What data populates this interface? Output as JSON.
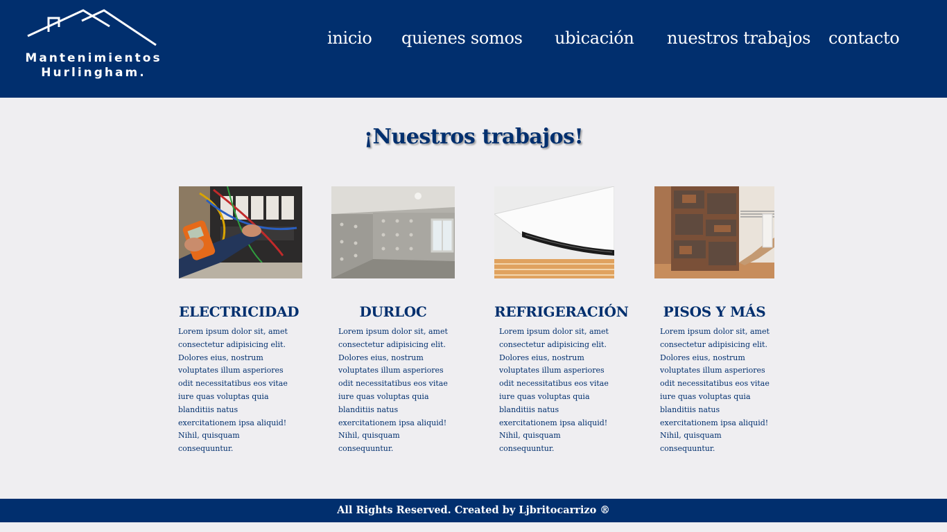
{
  "brand": {
    "line1": "Mantenimientos",
    "line2": "Hurlingham."
  },
  "nav": {
    "inicio": "inicio",
    "quienes": "quienes somos",
    "ubicacion": "ubicación",
    "trabajos": "nuestros trabajos",
    "contacto": "contacto"
  },
  "main": {
    "title": "¡Nuestros trabajos!"
  },
  "cards": [
    {
      "title": "ELECTRICIDAD",
      "image": "electrical-panel-photo",
      "lines": [
        "Lorem ipsum dolor sit, amet",
        "consectetur adipisicing elit.",
        "Dolores eius, nostrum",
        "voluptates illum asperiores",
        "odit necessitatibus eos vitae",
        "iure quas voluptas quia",
        "blanditiis natus",
        "exercitationem ipsa aliquid!",
        "Nihil, quisquam",
        "consequuntur."
      ]
    },
    {
      "title": "DURLOC",
      "image": "drywall-room-photo",
      "lines": [
        "Lorem ipsum dolor sit, amet",
        "consectetur adipisicing elit.",
        "Dolores eius, nostrum",
        "voluptates illum asperiores",
        "odit necessitatibus eos vitae",
        "iure quas voluptas quia",
        "blanditiis natus",
        "exercitationem ipsa aliquid!",
        "Nihil, quisquam",
        "consequuntur."
      ]
    },
    {
      "title": "REFRIGERACIÓN",
      "image": "air-conditioner-photo",
      "lines": [
        "Lorem ipsum dolor sit, amet",
        "consectetur adipisicing elit.",
        "Dolores eius, nostrum",
        "voluptates illum asperiores",
        "odit necessitatibus eos vitae",
        "iure quas voluptas quia",
        "blanditiis natus",
        "exercitationem ipsa aliquid!",
        "Nihil, quisquam",
        "consequuntur."
      ]
    },
    {
      "title": "PISOS Y MÁS",
      "image": "stone-wall-floor-photo",
      "lines": [
        "Lorem ipsum dolor sit, amet",
        "consectetur adipisicing elit.",
        "Dolores eius, nostrum",
        "voluptates illum asperiores",
        "odit necessitatibus eos vitae",
        "iure quas voluptas quia",
        "blanditiis natus",
        "exercitationem ipsa aliquid!",
        "Nihil, quisquam",
        "consequuntur."
      ]
    }
  ],
  "footer": {
    "text": "All Rights Reserved. Created by Ljbritocarrizo ®"
  },
  "colors": {
    "primary": "#012f6e",
    "background": "#efeef1",
    "header_text": "#ffffff"
  }
}
